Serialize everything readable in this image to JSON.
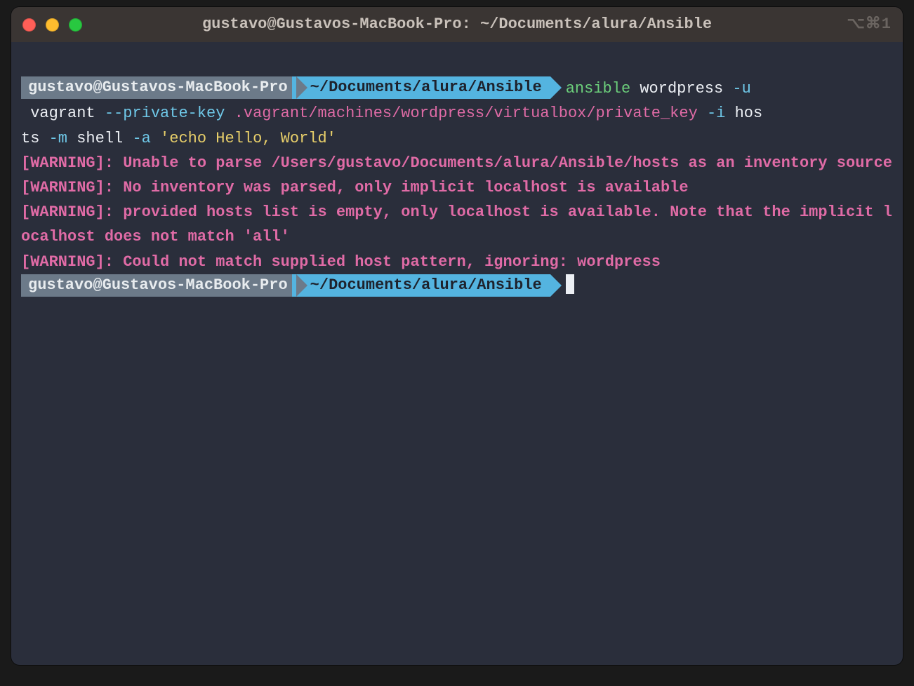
{
  "titlebar": {
    "title": "gustavo@Gustavos-MacBook-Pro: ~/Documents/alura/Ansible",
    "shortcut": "⌥⌘1"
  },
  "prompt1": {
    "host": "gustavo@Gustavos-MacBook-Pro",
    "path": "~/Documents/alura/Ansible",
    "cmd": {
      "name": "ansible",
      "arg_host": " wordpress ",
      "flag_u": "-u",
      "wrap1_a": " vagrant ",
      "flag_pk": "--private-key",
      "pk_path": " .vagrant/machines/wordpress/virtualbox/private_key",
      "flag_i": " -i",
      "wrap2_a": " hos",
      "wrap2_b": "ts ",
      "flag_m": "-m",
      "arg_m": " shell ",
      "flag_a": "-a",
      "str": " 'echo Hello, World'"
    }
  },
  "output": {
    "w1": "[WARNING]: Unable to parse /Users/gustavo/Documents/alura/Ansible/hosts as an inventory source",
    "w2": "[WARNING]: No inventory was parsed, only implicit localhost is available",
    "w3": "[WARNING]: provided hosts list is empty, only localhost is available. Note that the implicit localhost does not match 'all'",
    "w4": "[WARNING]: Could not match supplied host pattern, ignoring: wordpress"
  },
  "prompt2": {
    "host": "gustavo@Gustavos-MacBook-Pro",
    "path": "~/Documents/alura/Ansible"
  }
}
